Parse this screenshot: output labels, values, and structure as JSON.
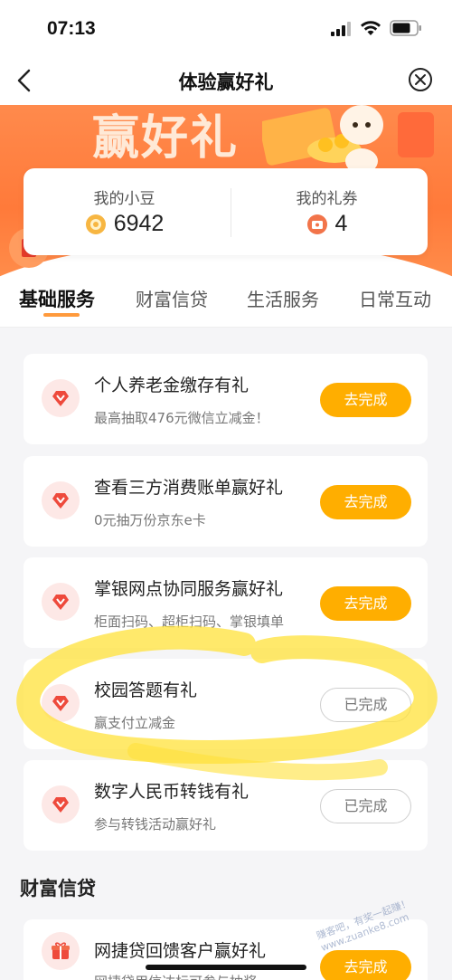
{
  "status_bar": {
    "time": "07:13"
  },
  "nav": {
    "title": "体验赢好礼"
  },
  "banner": {
    "heading": "赢好礼"
  },
  "stats": [
    {
      "label": "我的小豆",
      "value": "6942",
      "icon": "coin-icon"
    },
    {
      "label": "我的礼券",
      "value": "4",
      "icon": "coupon-icon"
    }
  ],
  "tabs": [
    {
      "label": "基础服务",
      "active": true
    },
    {
      "label": "财富信贷",
      "active": false
    },
    {
      "label": "生活服务",
      "active": false
    },
    {
      "label": "日常互动",
      "active": false
    }
  ],
  "tasks": [
    {
      "title": "个人养老金缴存有礼",
      "subtitle": "最高抽取476元微信立减金！",
      "button": "去完成",
      "completed": false
    },
    {
      "title": "查看三方消费账单赢好礼",
      "subtitle": "0元抽万份京东e卡",
      "button": "去完成",
      "completed": false
    },
    {
      "title": "掌银网点协同服务赢好礼",
      "subtitle": "柜面扫码、超柜扫码、掌银填单",
      "button": "去完成",
      "completed": false
    },
    {
      "title": "校园答题有礼",
      "subtitle": "赢支付立减金",
      "button": "已完成",
      "completed": true
    },
    {
      "title": "数字人民币转钱有礼",
      "subtitle": "参与转钱活动赢好礼",
      "button": "已完成",
      "completed": true
    }
  ],
  "section2": {
    "title": "财富信贷",
    "tasks": [
      {
        "title": "网捷贷回馈客户赢好礼",
        "subtitle": "网捷贷用信达标可参与抽奖",
        "button": "去完成",
        "completed": false
      }
    ]
  },
  "watermark": "赚客吧，有奖一起赚！ www.zuanke8.com",
  "colors": {
    "accent_orange": "#ffae00",
    "banner_orange": "#ff7a3a",
    "tab_indicator": "#ff9a3c",
    "highlight_yellow": "#ffe13a"
  }
}
